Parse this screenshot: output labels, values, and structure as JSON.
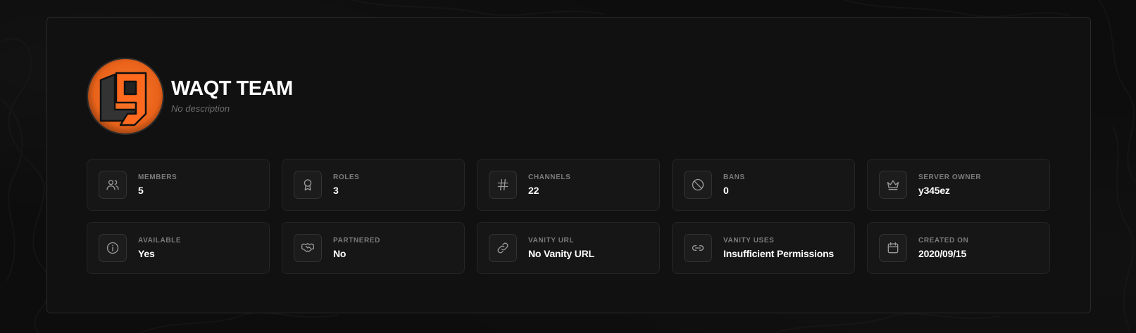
{
  "server": {
    "name": "WAQT TEAM",
    "description": "No description",
    "accent_color": "#ff6a1f"
  },
  "stats": [
    {
      "key": "members",
      "label": "MEMBERS",
      "value": "5",
      "icon": "users-icon"
    },
    {
      "key": "roles",
      "label": "ROLES",
      "value": "3",
      "icon": "award-icon"
    },
    {
      "key": "channels",
      "label": "CHANNELS",
      "value": "22",
      "icon": "hash-icon"
    },
    {
      "key": "bans",
      "label": "BANS",
      "value": "0",
      "icon": "ban-icon"
    },
    {
      "key": "server_owner",
      "label": "SERVER OWNER",
      "value": "y345ez",
      "icon": "crown-icon"
    },
    {
      "key": "available",
      "label": "AVAILABLE",
      "value": "Yes",
      "icon": "info-icon"
    },
    {
      "key": "partnered",
      "label": "PARTNERED",
      "value": "No",
      "icon": "handshake-icon"
    },
    {
      "key": "vanity_url",
      "label": "VANITY URL",
      "value": "No Vanity URL",
      "icon": "link-icon"
    },
    {
      "key": "vanity_uses",
      "label": "VANITY USES",
      "value": "Insufficient Permissions",
      "icon": "link-horizontal-icon"
    },
    {
      "key": "created_on",
      "label": "CREATED ON",
      "value": "2020/09/15",
      "icon": "calendar-icon"
    }
  ]
}
